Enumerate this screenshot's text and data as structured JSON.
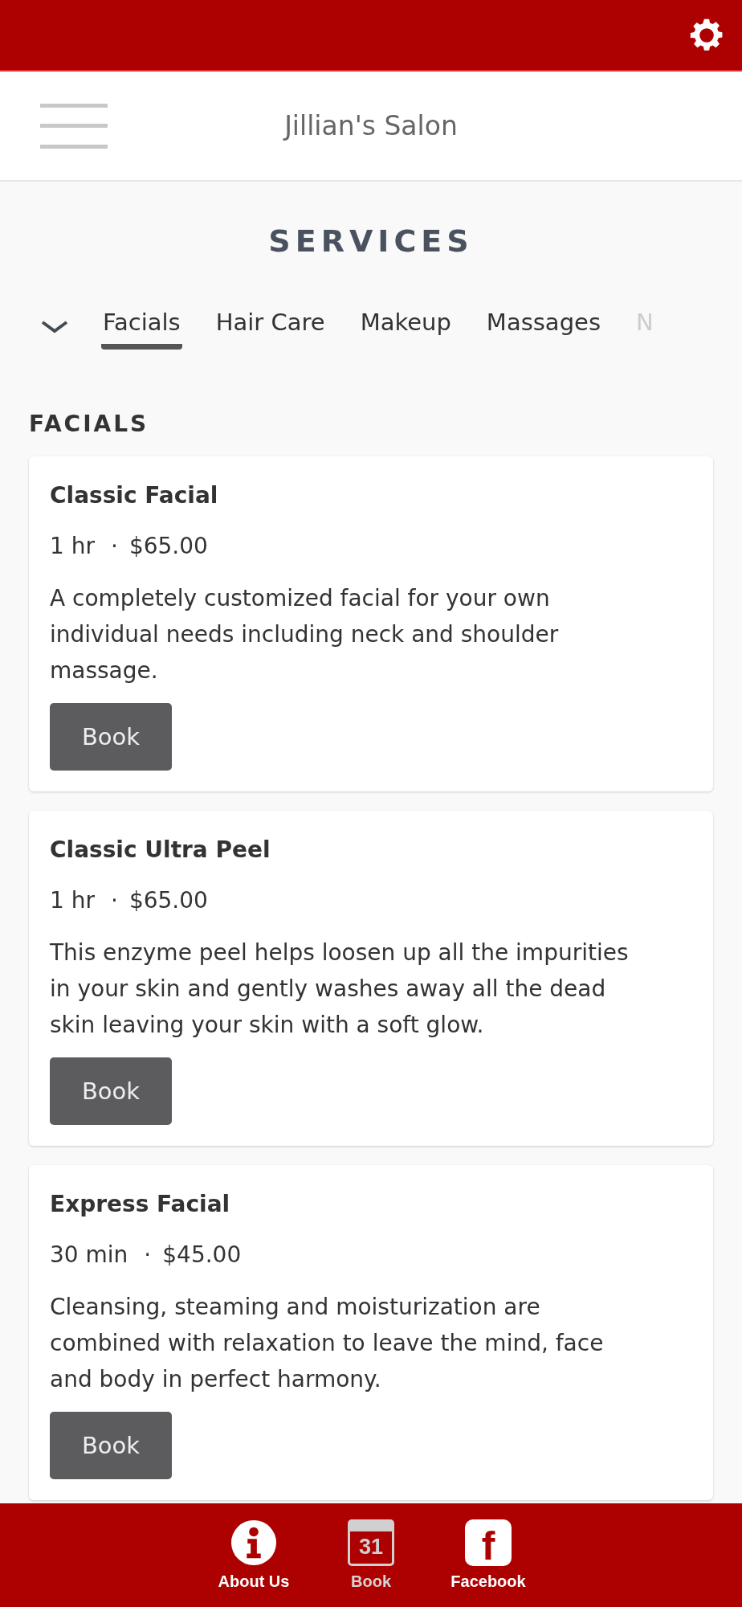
{
  "header": {
    "title": "Jillian's Salon"
  },
  "page_title": "SERVICES",
  "tabs": [
    {
      "label": "Facials",
      "selected": true
    },
    {
      "label": "Hair Care",
      "selected": false
    },
    {
      "label": "Makeup",
      "selected": false
    },
    {
      "label": "Massages",
      "selected": false
    },
    {
      "label": "N",
      "selected": false
    }
  ],
  "section_title": "FACIALS",
  "services": [
    {
      "name": "Classic Facial",
      "duration": "1 hr",
      "separator": "·",
      "price": "$65.00",
      "description": "A completely customized facial for your own individual needs including neck and shoulder massage.",
      "button": "Book"
    },
    {
      "name": "Classic Ultra Peel",
      "duration": "1 hr",
      "separator": "·",
      "price": "$65.00",
      "description": "This enzyme peel helps loosen up all the impurities in your skin and gently washes away all the dead skin leaving your skin with a soft glow.",
      "button": "Book"
    },
    {
      "name": "Express Facial",
      "duration": "30 min",
      "separator": "·",
      "price": "$45.00",
      "description": "Cleansing, steaming and moisturization are combined with relaxation to leave the mind, face and body in perfect harmony.",
      "button": "Book"
    }
  ],
  "bottom_nav": [
    {
      "kind": "info",
      "label": "About Us",
      "selected": false
    },
    {
      "kind": "calendar",
      "label": "Book",
      "icon_text": "31",
      "selected": true
    },
    {
      "kind": "facebook",
      "label": "Facebook",
      "icon_text": "f",
      "selected": false
    }
  ]
}
